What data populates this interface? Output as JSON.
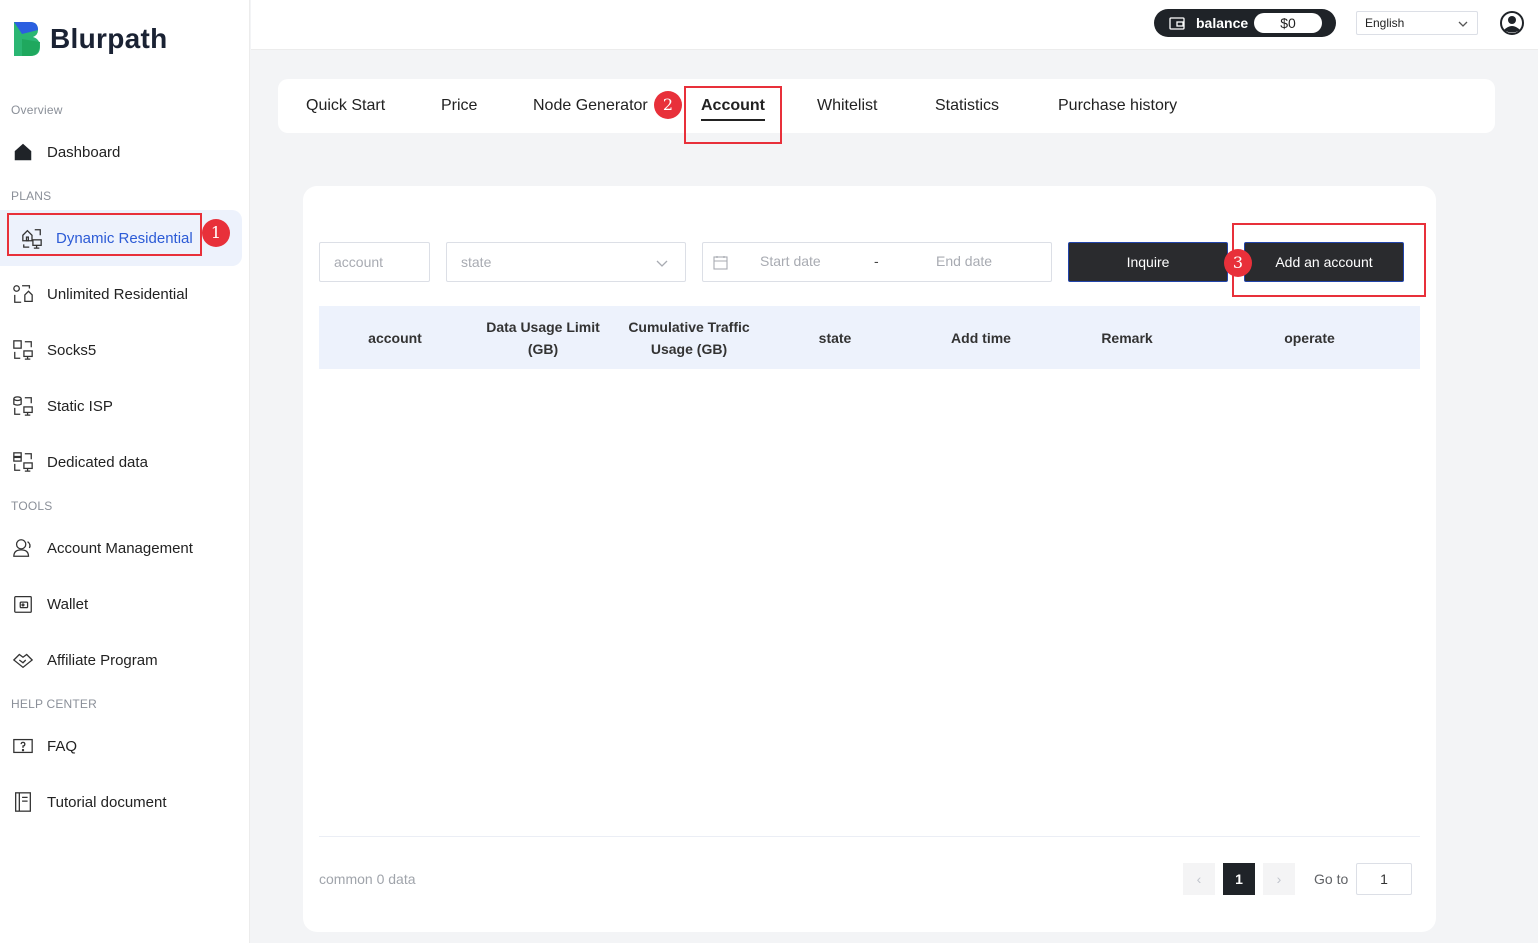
{
  "brand": {
    "name": "Blurpath"
  },
  "sidebar": {
    "sections": {
      "overview": "Overview",
      "plans": "PLANS",
      "tools": "TOOLS",
      "help": "HELP CENTER"
    },
    "items": [
      {
        "label": "Dashboard",
        "icon": "home-icon"
      },
      {
        "label": "Dynamic Residential",
        "icon": "dynamic-residential-icon",
        "active": true
      },
      {
        "label": "Unlimited Residential",
        "icon": "unlimited-residential-icon"
      },
      {
        "label": "Socks5",
        "icon": "socks5-icon"
      },
      {
        "label": "Static ISP",
        "icon": "static-isp-icon"
      },
      {
        "label": "Dedicated data",
        "icon": "dedicated-data-icon"
      },
      {
        "label": "Account Management",
        "icon": "user-icon"
      },
      {
        "label": "Wallet",
        "icon": "wallet-icon"
      },
      {
        "label": "Affiliate Program",
        "icon": "handshake-icon"
      },
      {
        "label": "FAQ",
        "icon": "faq-icon"
      },
      {
        "label": "Tutorial document",
        "icon": "document-icon"
      }
    ]
  },
  "topbar": {
    "balance_label": "balance",
    "balance_value": "$0",
    "language": "English"
  },
  "tabs": [
    {
      "label": "Quick Start"
    },
    {
      "label": "Price"
    },
    {
      "label": "Node Generator"
    },
    {
      "label": "Account",
      "active": true
    },
    {
      "label": "Whitelist"
    },
    {
      "label": "Statistics"
    },
    {
      "label": "Purchase history"
    }
  ],
  "filters": {
    "account_placeholder": "account",
    "state_placeholder": "state",
    "start_date_placeholder": "Start date",
    "date_separator": "-",
    "end_date_placeholder": "End date",
    "inquire_label": "Inquire",
    "add_account_label": "Add an account"
  },
  "table": {
    "columns": [
      "account",
      "Data Usage Limit (GB)",
      "Cumulative Traffic Usage (GB)",
      "state",
      "Add time",
      "Remark",
      "operate"
    ],
    "rows": []
  },
  "pagination": {
    "total_text": "common 0 data",
    "prev": "‹",
    "current_page": "1",
    "next": "›",
    "goto_label": "Go to",
    "goto_value": "1"
  },
  "annotations": {
    "marker_1": "1",
    "marker_2": "2",
    "marker_3": "3",
    "color": "#e8303a"
  },
  "colors": {
    "accent": "#2c5bd6",
    "dark": "#1f2328",
    "active_bg": "#edf2fc"
  }
}
